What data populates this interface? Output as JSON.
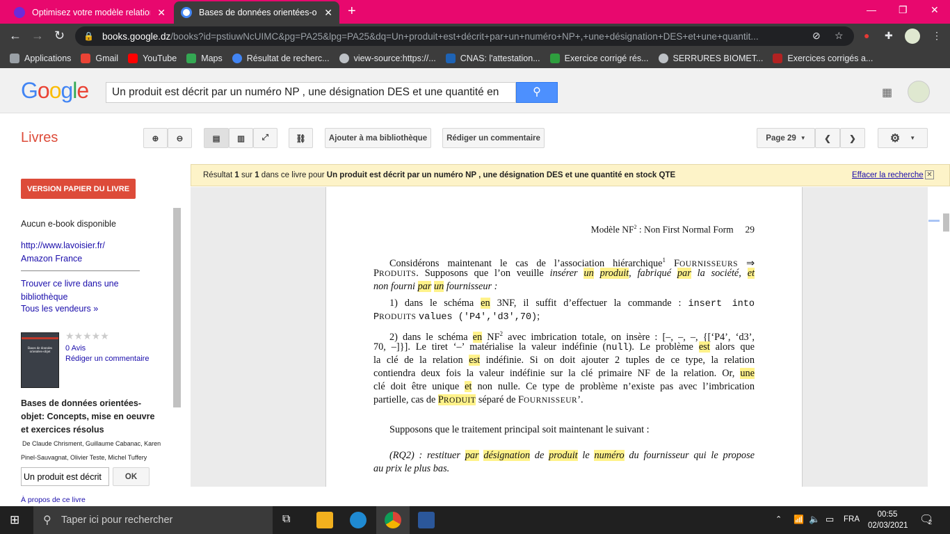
{
  "tabs": [
    {
      "title": "Optimisez votre modèle relationnel",
      "color": "#6b2bd9"
    },
    {
      "title": "Bases de données orientées-objet",
      "color": "#4285f4"
    }
  ],
  "address": {
    "host": "books.google.dz",
    "path": "/books?id=pstiuwNcUIMC&pg=PA25&lpg=PA25&dq=Un+produit+est+décrit+par+un+numéro+NP+,+une+désignation+DES+et+une+quantit..."
  },
  "bookmarks": [
    {
      "label": "Applications",
      "color": "#9aa0a6"
    },
    {
      "label": "Gmail",
      "color": "#ea4335"
    },
    {
      "label": "YouTube",
      "color": "#ff0000"
    },
    {
      "label": "Maps",
      "color": "#34a853"
    },
    {
      "label": "Résultat de recherc...",
      "color": "#4285f4"
    },
    {
      "label": "view-source:https://...",
      "color": "#bdc1c6"
    },
    {
      "label": "CNAS: l'attestation...",
      "color": "#1e63b5"
    },
    {
      "label": "Exercice corrigé rés...",
      "color": "#2e9e3e"
    },
    {
      "label": "SERRURES BIOMET...",
      "color": "#bdc1c6"
    },
    {
      "label": "Exercices corrigés a...",
      "color": "#b22222"
    }
  ],
  "google": {
    "query": "Un produit est décrit par un numéro NP , une désignation DES et une quantité en"
  },
  "books_bar": {
    "title": "Livres",
    "add_library": "Ajouter à ma bibliothèque",
    "write_review": "Rédiger un commentaire",
    "page_select": "Page 29"
  },
  "sidebar": {
    "version_btn": "VERSION PAPIER DU LIVRE",
    "no_ebook": "Aucun e-book disponible",
    "link1": "http://www.lavoisier.fr/",
    "link2": "Amazon France",
    "find_library": "Trouver ce livre dans une bibliothèque",
    "all_sellers": "Tous les vendeurs »",
    "stars": "★★★★★",
    "reviews": "0 Avis",
    "write_review": "Rédiger un commentaire",
    "cover_title": "Bases de données orientées-objet",
    "book_title": "Bases de données orientées-objet: Concepts, mise en oeuvre et exercices résolus",
    "authors_line1": "De Claude Chrisment, Guillaume Cabanac, Karen",
    "authors_line2": "Pinel-Sauvagnat, Olivier Teste, Michel Tuffery",
    "search_value": "Un produit est décrit",
    "ok": "OK",
    "about": "À propos de ce livre"
  },
  "banner": {
    "prefix": "Résultat",
    "n1": "1",
    "sur": "sur",
    "n2": "1",
    "mid": "dans ce livre pour",
    "query": "Un produit est décrit par un numéro NP , une désignation DES et une quantité en stock QTE",
    "clear": "Effacer la recherche"
  },
  "page": {
    "header": "Modèle NF",
    "header_sup": "2",
    "header_rest": " : Non First Normal Form",
    "page_num": "29"
  },
  "taskbar": {
    "search_placeholder": "Taper ici pour rechercher",
    "lang": "FRA",
    "time": "00:55",
    "date": "02/03/2021",
    "notif_count": "2"
  }
}
